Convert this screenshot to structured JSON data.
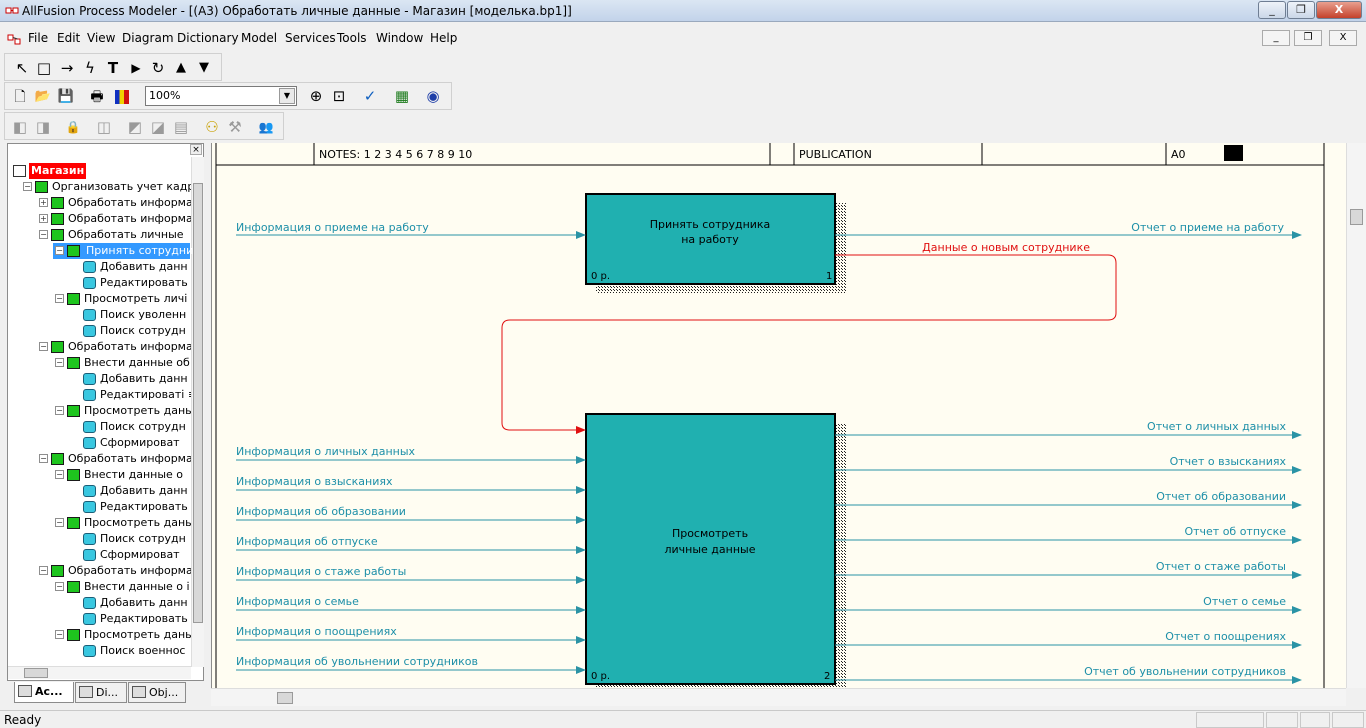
{
  "window": {
    "title": "AllFusion Process Modeler - [(A3) Обработать  личные данные  - Магазин  [моделька.bp1]]"
  },
  "title_buttons": [
    "_",
    "❐",
    "X"
  ],
  "menu": [
    "File",
    "Edit",
    "View",
    "Diagram",
    "Dictionary",
    "Model",
    "Services",
    "Tools",
    "Window",
    "Help"
  ],
  "mdi_buttons": [
    "_",
    "❐",
    "X"
  ],
  "toolbar": {
    "drawing_tools": [
      {
        "icon": "pointer-icon",
        "glyph": "↖"
      },
      {
        "icon": "box-tool-icon",
        "glyph": "□"
      },
      {
        "icon": "arrow-tool-icon",
        "glyph": "→"
      },
      {
        "icon": "squiggle-tool-icon",
        "glyph": "ϟ"
      },
      {
        "icon": "text-tool-icon",
        "glyph": "T"
      },
      {
        "icon": "triangle-right-icon",
        "glyph": "▶"
      },
      {
        "icon": "rotate-icon",
        "glyph": "↻"
      },
      {
        "icon": "go-up-icon",
        "glyph": "▲"
      },
      {
        "icon": "go-down-icon",
        "glyph": "▼"
      }
    ],
    "standard": [
      {
        "icon": "new-file-icon",
        "glyph": "🗋"
      },
      {
        "icon": "open-folder-icon",
        "glyph": "📂"
      },
      {
        "icon": "save-icon",
        "glyph": "💾"
      },
      {
        "icon": "print-icon",
        "glyph": "🖶"
      },
      {
        "icon": "color-palette-icon",
        "glyph": "▌"
      }
    ],
    "zoom_value": "100%",
    "view_tools": [
      {
        "icon": "zoom-in-icon",
        "glyph": "⊕"
      },
      {
        "icon": "zoom-fit-icon",
        "glyph": "⊡"
      },
      {
        "icon": "spell-check-icon",
        "glyph": "✓"
      },
      {
        "icon": "model-explorer-icon",
        "glyph": "▦"
      },
      {
        "icon": "globe-icon",
        "glyph": "◉"
      }
    ],
    "model_mart": [
      {
        "icon": "mart-connect-icon",
        "glyph": "◧"
      },
      {
        "icon": "mart-disconnect-icon",
        "glyph": "◨"
      },
      {
        "icon": "lock-icon",
        "glyph": "🔒"
      },
      {
        "icon": "mart-open-icon",
        "glyph": "◫"
      },
      {
        "icon": "mart-save-icon",
        "glyph": "◩"
      },
      {
        "icon": "mart-merge-icon",
        "glyph": "◪"
      },
      {
        "icon": "mart-grid-icon",
        "glyph": "▤"
      },
      {
        "icon": "mart-users-icon",
        "glyph": "⚇"
      },
      {
        "icon": "mart-tools-icon",
        "glyph": "⚒"
      },
      {
        "icon": "people-icon",
        "glyph": "👥"
      }
    ]
  },
  "explorer": {
    "tree": [
      {
        "label": "Магазин",
        "level": 0,
        "kind": "root"
      },
      {
        "label": "Организовать учет кадр",
        "level": 1,
        "kind": "green",
        "exp": "−"
      },
      {
        "label": "Обработать информа",
        "level": 2,
        "kind": "green",
        "exp": "+"
      },
      {
        "label": "Обработать информа",
        "level": 2,
        "kind": "green",
        "exp": "+"
      },
      {
        "label": "Обработать  личные",
        "level": 2,
        "kind": "green",
        "exp": "−"
      },
      {
        "label": "Принять сотрудни",
        "level": 3,
        "kind": "green",
        "exp": "−",
        "selected": true
      },
      {
        "label": "Добавить данн",
        "level": 4,
        "kind": "cyl"
      },
      {
        "label": "Редактировать",
        "level": 4,
        "kind": "cyl"
      },
      {
        "label": "Просмотреть  личі",
        "level": 3,
        "kind": "green",
        "exp": "−"
      },
      {
        "label": "Поиск уволенн",
        "level": 4,
        "kind": "cyl"
      },
      {
        "label": "Поиск сотрудн",
        "level": 4,
        "kind": "cyl"
      },
      {
        "label": "Обработать информа",
        "level": 2,
        "kind": "green",
        "exp": "−"
      },
      {
        "label": "Внести данные  об",
        "level": 3,
        "kind": "green",
        "exp": "−"
      },
      {
        "label": "Добавить данн",
        "level": 4,
        "kind": "cyl"
      },
      {
        "label": "Редактироваті ≡",
        "level": 4,
        "kind": "cyl"
      },
      {
        "label": "Просмотреть дань",
        "level": 3,
        "kind": "green",
        "exp": "−"
      },
      {
        "label": "Поиск сотрудн",
        "level": 4,
        "kind": "cyl"
      },
      {
        "label": "Сформироват",
        "level": 4,
        "kind": "cyl"
      },
      {
        "label": "Обработать информа",
        "level": 2,
        "kind": "green",
        "exp": "−"
      },
      {
        "label": "Внести данные  о",
        "level": 3,
        "kind": "green",
        "exp": "−"
      },
      {
        "label": "Добавить данн",
        "level": 4,
        "kind": "cyl"
      },
      {
        "label": "Редактировать",
        "level": 4,
        "kind": "cyl"
      },
      {
        "label": "Просмотреть дань",
        "level": 3,
        "kind": "green",
        "exp": "−"
      },
      {
        "label": "Поиск сотрудн",
        "level": 4,
        "kind": "cyl"
      },
      {
        "label": "Сформироват",
        "level": 4,
        "kind": "cyl"
      },
      {
        "label": "Обработать информа",
        "level": 2,
        "kind": "green",
        "exp": "−"
      },
      {
        "label": "Внести данные о і",
        "level": 3,
        "kind": "green",
        "exp": "−"
      },
      {
        "label": "Добавить данн",
        "level": 4,
        "kind": "cyl"
      },
      {
        "label": "Редактировать",
        "level": 4,
        "kind": "cyl"
      },
      {
        "label": "Просмотреть дань",
        "level": 3,
        "kind": "green",
        "exp": "−"
      },
      {
        "label": "Поиск военноc",
        "level": 4,
        "kind": "cyl"
      }
    ],
    "tabs": [
      "Ac...",
      "Di...",
      "Obj..."
    ]
  },
  "diagram": {
    "header": {
      "notes": "NOTES: 1 2 3 4 5 6 7 8 9 10",
      "publication": "PUBLICATION",
      "node": "A0"
    },
    "boxes": [
      {
        "name": "activity-box-hire",
        "line1": "Принять сотрудника",
        "line2": "на работу",
        "cost": "0 р.",
        "num": "1"
      },
      {
        "name": "activity-box-view",
        "line1": "Просмотреть",
        "line2": "личные данные",
        "cost": "0 р.",
        "num": "2"
      }
    ],
    "inputs_top": [
      "Информация о приеме на  работу"
    ],
    "outputs_top": [
      "Отчет о приеме на работу"
    ],
    "feedback_label": "Данные о новым сотруднике",
    "inputs_bottom": [
      "Информация о личных данных",
      "Информация о взысканиях",
      "Информация об образовании",
      "Информация об отпуске",
      "Информация о стаже работы",
      "Информация о семье",
      "Информация о поощрениях",
      "Информация об увольнении сотрудников"
    ],
    "outputs_bottom": [
      "Отчет о личных данных",
      "Отчет о взысканиях",
      "Отчет об образовании",
      "Отчет об отпуске",
      "Отчет о стаже работы",
      "Отчет о семье",
      "Отчет о поощрениях",
      "Отчет об увольнении сотрудников"
    ],
    "colors": {
      "arrow": "#2a93a5",
      "box_fill": "#20b0b0",
      "feedback": "#e01010",
      "label": "#1d8fa8",
      "canvas": "#fffdf2"
    }
  },
  "status": {
    "text": "Ready"
  }
}
